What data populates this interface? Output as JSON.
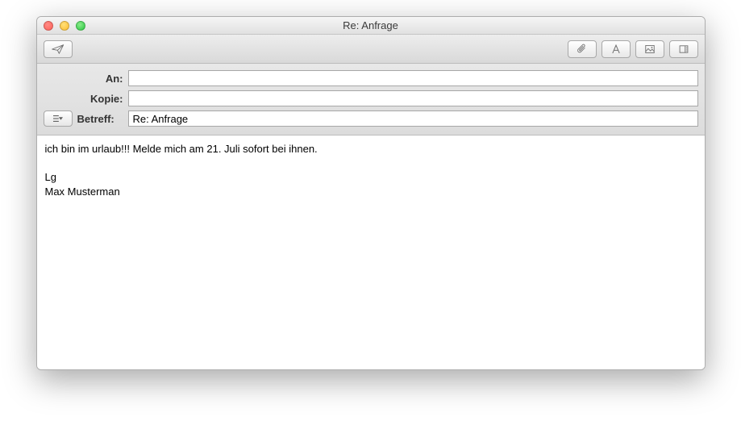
{
  "window": {
    "title": "Re: Anfrage"
  },
  "fields": {
    "to_label": "An:",
    "to_value": "",
    "cc_label": "Kopie:",
    "cc_value": "",
    "subject_label": "Betreff:",
    "subject_value": "Re: Anfrage"
  },
  "body": "ich bin im urlaub!!! Melde mich am 21. Juli sofort bei ihnen.\n\nLg\nMax Musterman"
}
